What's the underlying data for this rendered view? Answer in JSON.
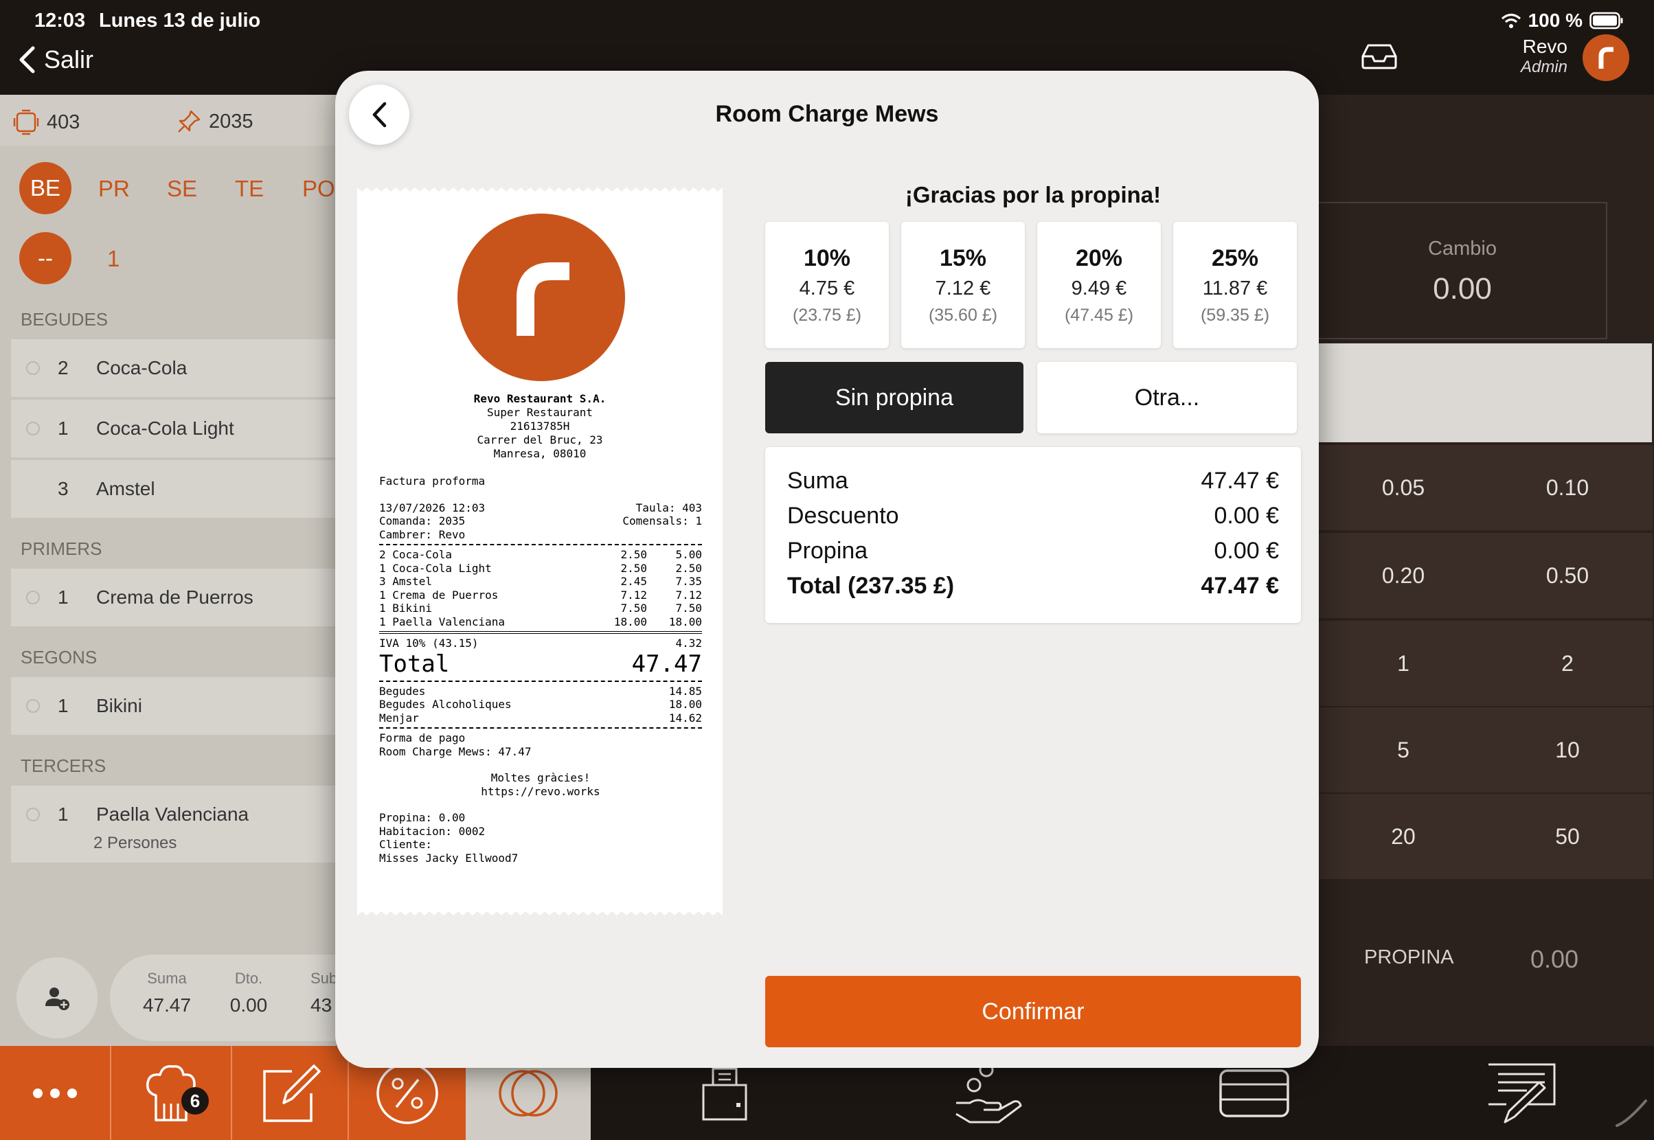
{
  "status_bar": {
    "time": "12:03",
    "date": "Lunes 13 de julio",
    "battery": "100 %"
  },
  "nav": {
    "back_label": "Salir"
  },
  "user": {
    "name": "Revo",
    "role": "Admin"
  },
  "order": {
    "table": "403",
    "order_number": "2035",
    "course_tabs": [
      "BE",
      "PR",
      "SE",
      "TE",
      "PO"
    ],
    "diners_circle": "--",
    "diners_count": "1",
    "sections": [
      {
        "title": "BEGUDES",
        "items": [
          {
            "qty": "2",
            "name": "Coca-Cola"
          },
          {
            "qty": "1",
            "name": "Coca-Cola Light"
          },
          {
            "qty": "3",
            "name": "Amstel"
          }
        ]
      },
      {
        "title": "PRIMERS",
        "items": [
          {
            "qty": "1",
            "name": "Crema de Puerros"
          }
        ]
      },
      {
        "title": "SEGONS",
        "items": [
          {
            "qty": "1",
            "name": "Bikini"
          }
        ]
      },
      {
        "title": "TERCERS",
        "items": [
          {
            "qty": "1",
            "name": "Paella Valenciana",
            "note": "2 Persones"
          }
        ]
      }
    ],
    "totals": {
      "suma_label": "Suma",
      "suma": "47.47",
      "dto_label": "Dto.",
      "dto": "0.00",
      "sub_label": "Sub",
      "sub": "43"
    }
  },
  "change_panel": {
    "cambio_label": "Cambio",
    "cambio_value": "0.00",
    "keys": [
      "0.05",
      "0.10",
      "0.20",
      "0.50",
      "1",
      "2",
      "5",
      "10",
      "20",
      "50"
    ],
    "propina_label": "PROPINA",
    "propina_value": "0.00"
  },
  "bottom_bar": {
    "badge_count": "6"
  },
  "modal": {
    "title": "Room Charge Mews",
    "tip_heading": "¡Gracias por la propina!",
    "tip_options": [
      {
        "pct": "10%",
        "eur": "4.75 €",
        "gbp": "(23.75 £)"
      },
      {
        "pct": "15%",
        "eur": "7.12 €",
        "gbp": "(35.60 £)"
      },
      {
        "pct": "20%",
        "eur": "9.49 €",
        "gbp": "(47.45 £)"
      },
      {
        "pct": "25%",
        "eur": "11.87 €",
        "gbp": "(59.35 £)"
      }
    ],
    "no_tip_label": "Sin propina",
    "other_label": "Otra...",
    "summary": {
      "suma_label": "Suma",
      "suma": "47.47 €",
      "descuento_label": "Descuento",
      "descuento": "0.00 €",
      "propina_label": "Propina",
      "propina": "0.00 €",
      "total_label": "Total (237.35 £)",
      "total": "47.47 €"
    },
    "confirm_label": "Confirmar"
  },
  "receipt": {
    "company": "Revo Restaurant S.A.",
    "restaurant": "Super Restaurant",
    "tax_id": "21613785H",
    "address": "Carrer del Bruc, 23",
    "city": "Manresa, 08010",
    "doc_type": "Factura proforma",
    "datetime": "13/07/2026 12:03",
    "table": "Taula: 403",
    "order": "Comanda: 2035",
    "diners": "Comensals: 1",
    "waiter": "Cambrer: Revo",
    "lines": [
      {
        "desc": "2 Coca-Cola",
        "unit": "2.50",
        "total": "5.00"
      },
      {
        "desc": "1 Coca-Cola Light",
        "unit": "2.50",
        "total": "2.50"
      },
      {
        "desc": "3 Amstel",
        "unit": "2.45",
        "total": "7.35"
      },
      {
        "desc": "1 Crema de Puerros",
        "unit": "7.12",
        "total": "7.12"
      },
      {
        "desc": "1 Bikini",
        "unit": "7.50",
        "total": "7.50"
      },
      {
        "desc": "1 Paella Valenciana",
        "unit": "18.00",
        "total": "18.00"
      }
    ],
    "iva": "IVA 10% (43.15)",
    "iva_value": "4.32",
    "total_label": "Total",
    "total_value": "47.47",
    "categories": [
      {
        "name": "Begudes",
        "value": "14.85"
      },
      {
        "name": "Begudes Alcoholiques",
        "value": "18.00"
      },
      {
        "name": "Menjar",
        "value": "14.62"
      }
    ],
    "payment_title": "Forma de pago",
    "payment_line": "Room Charge Mews: 47.47",
    "thanks": "Moltes gràcies!",
    "url": "https://revo.works",
    "tip_line": "Propina: 0.00",
    "room_line": "Habitacion: 0002",
    "client_line": "Cliente:",
    "client_name": "Misses Jacky Ellwood7"
  }
}
